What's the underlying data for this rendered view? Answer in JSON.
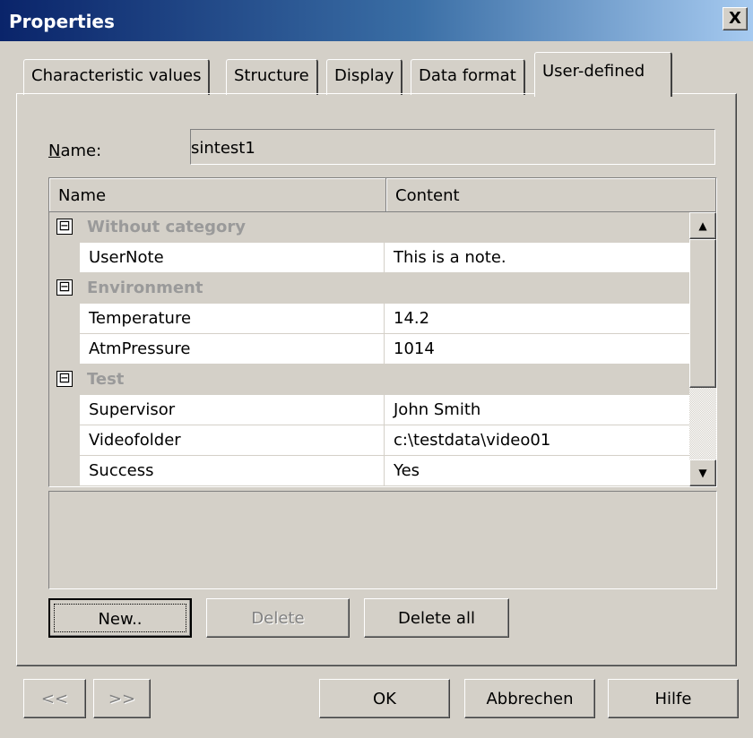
{
  "window": {
    "title": "Properties",
    "close_label": "X"
  },
  "tabs": [
    {
      "label": "Characteristic values",
      "active": false
    },
    {
      "label": "Structure",
      "active": false
    },
    {
      "label": "Display",
      "active": false
    },
    {
      "label": "Data format",
      "active": false
    },
    {
      "label": "User-defined",
      "active": true
    }
  ],
  "name": {
    "label_accel": "N",
    "label_rest": "ame:",
    "value": "sintest1"
  },
  "grid": {
    "columns": [
      "Name",
      "Content"
    ],
    "groups": [
      {
        "category": "Without category",
        "expander": "⊟",
        "rows": [
          {
            "name": "UserNote",
            "content": "This is a note."
          }
        ]
      },
      {
        "category": "Environment",
        "expander": "⊟",
        "rows": [
          {
            "name": "Temperature",
            "content": "14.2"
          },
          {
            "name": "AtmPressure",
            "content": "1014"
          }
        ]
      },
      {
        "category": "Test",
        "expander": "⊟",
        "rows": [
          {
            "name": "Supervisor",
            "content": "John Smith"
          },
          {
            "name": "Videofolder",
            "content": "c:\\testdata\\video01"
          },
          {
            "name": "Success",
            "content": "Yes"
          }
        ]
      }
    ],
    "scroll_up": "▲",
    "scroll_down": "▼"
  },
  "actions": {
    "new": "New..",
    "delete": "Delete",
    "delete_all": "Delete all"
  },
  "footer": {
    "prev": "<<",
    "next": ">>",
    "ok": "OK",
    "cancel": "Abbrechen",
    "help": "Hilfe"
  }
}
